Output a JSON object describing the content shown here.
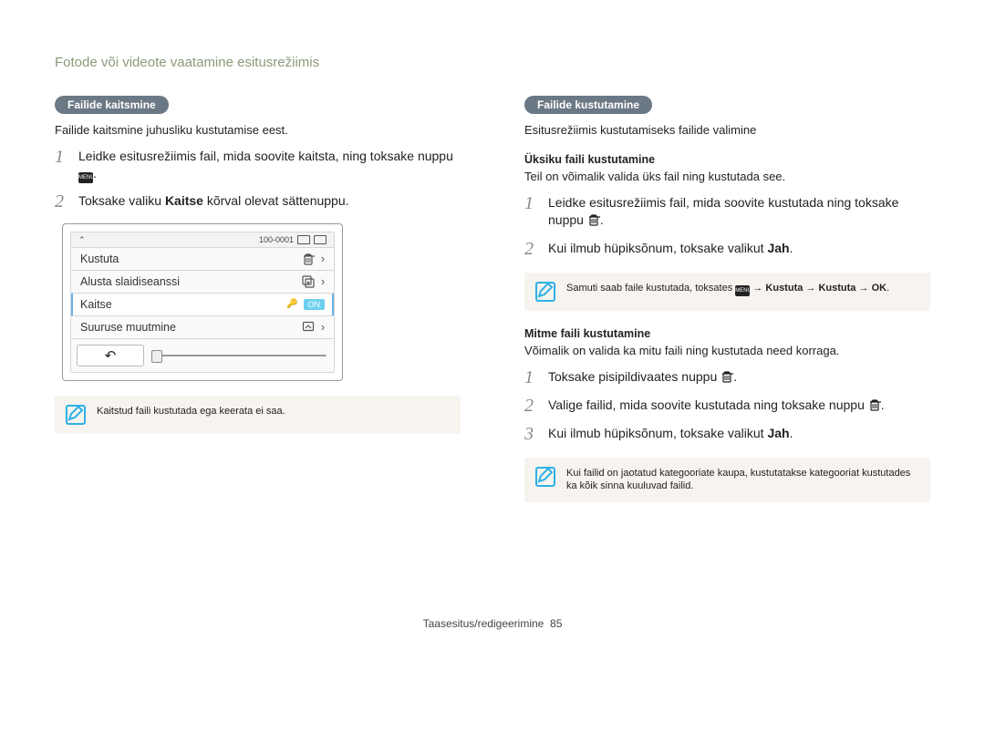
{
  "page_title": "Fotode või videote vaatamine esitusrežiimis",
  "left": {
    "pill": "Failide kaitsmine",
    "intro": "Failide kaitsmine juhusliku kustutamise eest.",
    "step1_pre": "Leidke esitusrežiimis fail, mida soovite kaitsta, ning toksake nuppu ",
    "menu_icon": "MENU",
    "step1_post": ".",
    "step2_pre": "Toksake valiku ",
    "step2_bold": "Kaitse",
    "step2_post": " kõrval olevat sättenuppu.",
    "scr": {
      "titlebar_counter": "100-0001",
      "rows": {
        "delete": "Kustuta",
        "slideshow": "Alusta slaidiseanssi",
        "protect": "Kaitse",
        "on": "ON",
        "resize": "Suuruse muutmine"
      },
      "back": "↶"
    },
    "note": "Kaitstud faili kustutada ega keerata ei saa."
  },
  "right": {
    "pill": "Failide kustutamine",
    "intro": "Esitusrežiimis kustutamiseks failide valimine",
    "single_head": "Üksiku faili kustutamine",
    "single_intro": "Teil on võimalik valida üks fail ning kustutada see.",
    "s1_pre": "Leidke esitusrežiimis fail, mida soovite kustutada ning toksake nuppu ",
    "s1_post": ".",
    "s2_pre": "Kui ilmub hüpiksõnum, toksake valikut ",
    "s2_bold": "Jah",
    "s2_post": ".",
    "note1_pre": "Samuti saab faile kustutada, toksates ",
    "note1_menu": "MENU",
    "note1_arrow1": " → ",
    "note1_b1": "Kustuta",
    "note1_arrow2": " → ",
    "note1_b2": "Kustuta",
    "note1_arrow3": " → ",
    "note1_ok": "OK",
    "note1_tail": ".",
    "multi_head": "Mitme faili kustutamine",
    "multi_intro": "Võimalik on valida ka mitu faili ning kustutada need korraga.",
    "m1_pre": "Toksake pisipildivaates nuppu ",
    "m1_post": ".",
    "m2_pre": "Valige failid, mida soovite kustutada ning toksake nuppu ",
    "m2_post": ".",
    "m3_pre": "Kui ilmub hüpiksõnum, toksake valikut ",
    "m3_bold": "Jah",
    "m3_post": ".",
    "note2": "Kui failid on jaotatud kategooriate kaupa, kustutatakse kategooriat kustutades ka kõik sinna kuuluvad failid."
  },
  "footer_label": "Taasesitus/redigeerimine",
  "footer_page": "85"
}
